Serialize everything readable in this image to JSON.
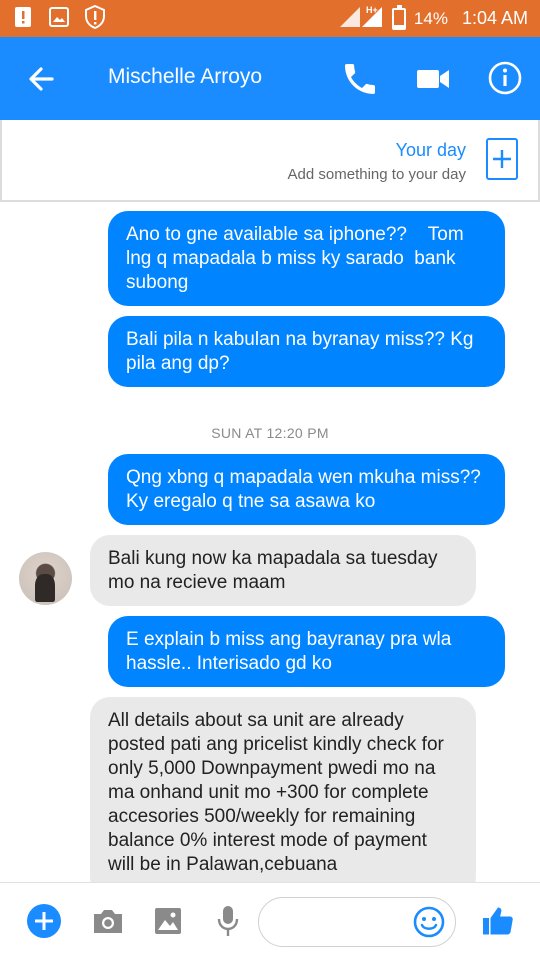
{
  "status_bar": {
    "battery": "14%",
    "time": "1:04 AM",
    "network": "H+"
  },
  "header": {
    "contact_name": "Mischelle Arroyo"
  },
  "your_day": {
    "title": "Your day",
    "subtitle": "Add something to your day"
  },
  "messages": [
    {
      "dir": "out",
      "text": "Ano to gne available sa iphone??    Tom lng q mapadala b miss ky sarado  bank subong"
    },
    {
      "dir": "out",
      "text": "Bali pila n kabulan na byranay miss?? Kg pila ang dp?"
    },
    {
      "dir": "out",
      "text": "Qng xbng q mapadala wen mkuha miss?? Ky eregalo q tne sa asawa ko"
    },
    {
      "dir": "in",
      "text": "Bali kung now ka mapadala sa tuesday mo na recieve maam"
    },
    {
      "dir": "out",
      "text": "E explain b miss ang bayranay pra wla hassle.. Interisado gd ko"
    },
    {
      "dir": "in",
      "text": "All details about sa unit are already posted pati ang pricelist kindly check for only 5,000 Downpayment pwedi mo na ma onhand unit mo +300 for complete accesories 500/weekly for remaining balance 0% interest mode of payment will be in Palawan,cebuana"
    }
  ],
  "timestamp": "SUN AT 12:20 PM",
  "composer": {
    "placeholder": ""
  },
  "colors": {
    "status_bar": "#e36f2c",
    "header": "#1a8cff",
    "outgoing_bubble": "#0084ff",
    "incoming_bubble": "#e9e9e9"
  },
  "icons": [
    "alert-icon",
    "image-icon",
    "shield-alert-icon",
    "signal-icon",
    "battery-icon",
    "back-arrow-icon",
    "phone-icon",
    "video-camera-icon",
    "info-icon",
    "plus-icon",
    "add-circle-icon",
    "camera-icon",
    "gallery-icon",
    "microphone-icon",
    "emoji-icon",
    "thumbs-up-icon"
  ]
}
